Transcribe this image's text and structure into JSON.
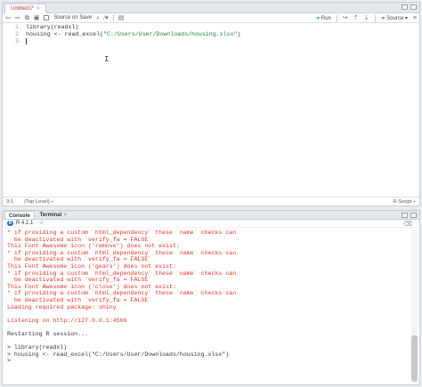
{
  "source": {
    "tab_label": "Untitled1*",
    "tab_close": "×",
    "toolbar": {
      "source_on_save": "Source on Save",
      "run_label": "Run",
      "source_label": "Source"
    },
    "gutter": [
      "1",
      "2",
      "3"
    ],
    "code": {
      "line1": "library(readxl)",
      "line2_prefix": "housing <- read_excel(",
      "line2_string": "\"C:/Users/User/Downloads/housing.xlsx\"",
      "line2_suffix": ")"
    },
    "status": {
      "position": "3:1",
      "scope": "(Top Level) ÷",
      "file_type": "R Script ÷"
    }
  },
  "console": {
    "tabs": [
      "Console",
      "Terminal"
    ],
    "tab_close": "×",
    "r_version": "R 4.1.1",
    "path_arrow": "· ~/",
    "lines": [
      {
        "text": "* if providing a custom `html_dependency` these `name` checks can",
        "cls": "err"
      },
      {
        "text": "  be deactivated with `verify_fa = FALSE`",
        "cls": "err"
      },
      {
        "text": "This Font Awesome icon ('remove') does not exist:",
        "cls": "err"
      },
      {
        "text": "* if providing a custom `html_dependency` these `name` checks can",
        "cls": "err"
      },
      {
        "text": "  be deactivated with `verify_fa = FALSE`",
        "cls": "err"
      },
      {
        "text": "This Font Awesome icon ('gears') does not exist:",
        "cls": "err"
      },
      {
        "text": "* if providing a custom `html_dependency` these `name` checks can",
        "cls": "err"
      },
      {
        "text": "  be deactivated with `verify_fa = FALSE`",
        "cls": "err"
      },
      {
        "text": "This Font Awesome icon ('close') does not exist:",
        "cls": "err"
      },
      {
        "text": "* if providing a custom `html_dependency` these `name` checks can",
        "cls": "err"
      },
      {
        "text": "  be deactivated with `verify_fa = FALSE`",
        "cls": "err"
      },
      {
        "text": "Loading required package: shiny",
        "cls": "msg"
      },
      {
        "text": "",
        "cls": "norm"
      },
      {
        "text": "Listening on http://127.0.0.1:4566",
        "cls": "msg"
      },
      {
        "text": "",
        "cls": "norm"
      },
      {
        "text": "Restarting R session...",
        "cls": "norm"
      },
      {
        "text": "",
        "cls": "norm"
      },
      {
        "text": "> library(readxl)",
        "cls": "norm"
      },
      {
        "text": "> housing <- read_excel(\"C:/Users/User/Downloads/housing.xlsx\")",
        "cls": "norm"
      },
      {
        "text": "> ",
        "cls": "norm"
      }
    ]
  }
}
